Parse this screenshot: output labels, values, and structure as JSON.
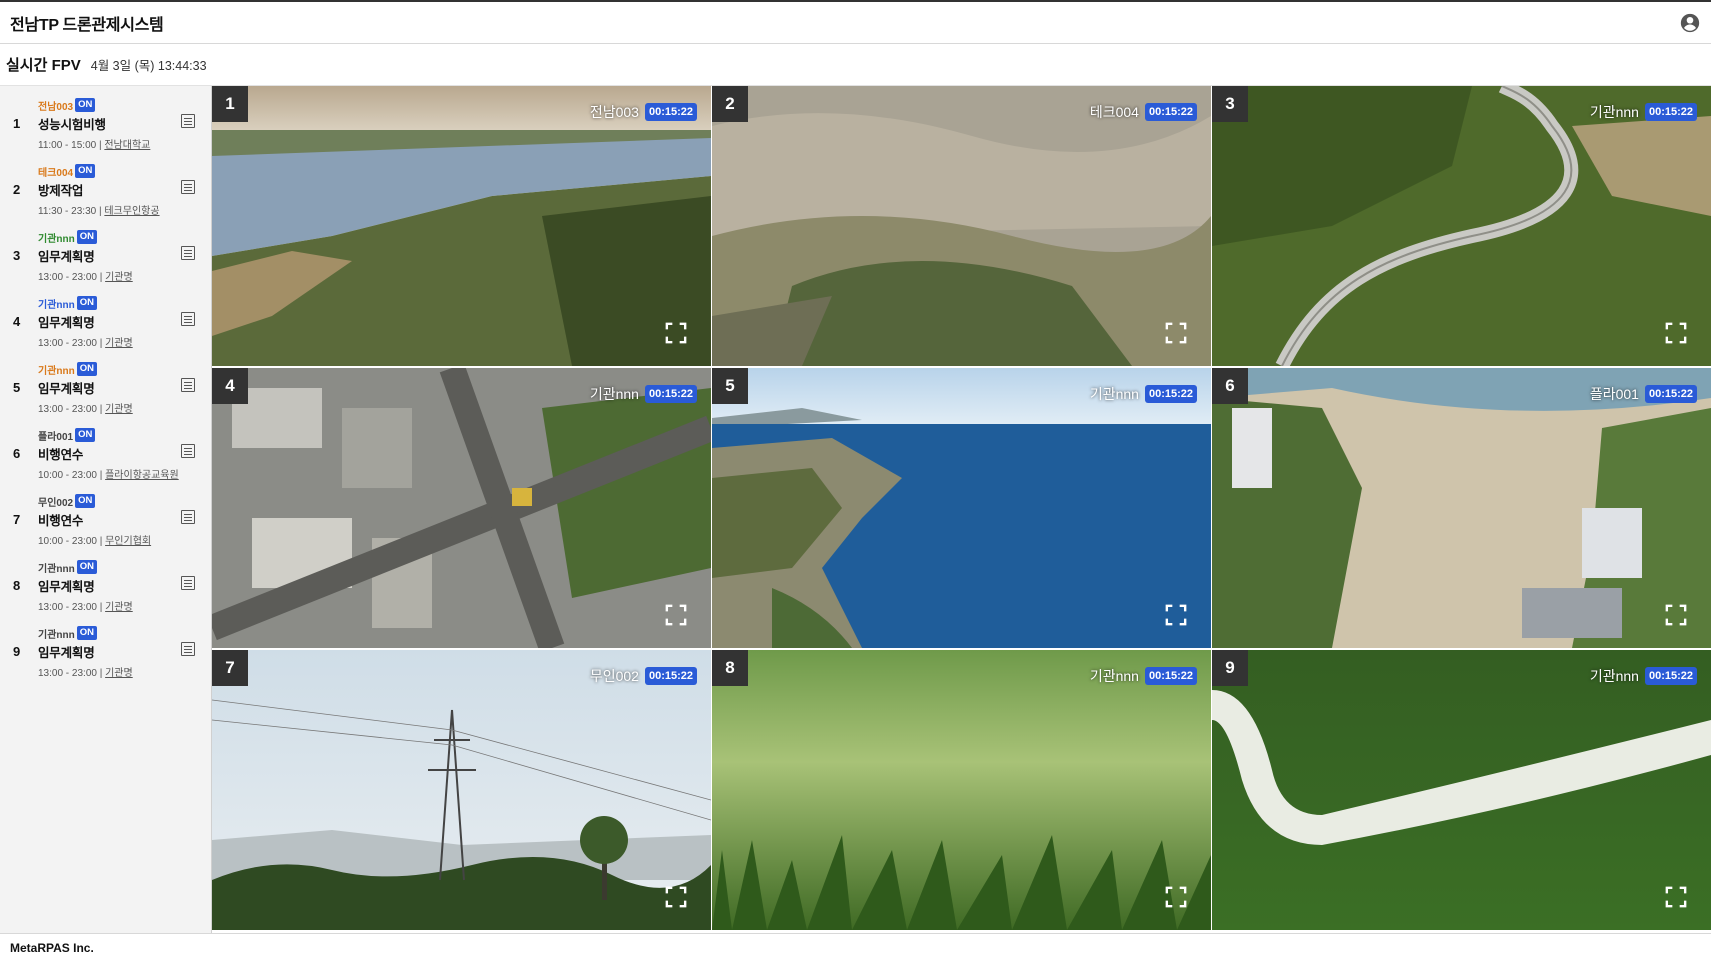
{
  "header": {
    "title": "전남TP 드론관제시스템",
    "account_icon": "account-circle-icon"
  },
  "subheader": {
    "title": "실시간 FPV",
    "datetime": "4월 3일 (목) 13:44:33"
  },
  "colors": {
    "accent": "#2a5bd7",
    "drone_orange": "#d9791a",
    "drone_green": "#2f8a2f",
    "drone_gray": "#444444"
  },
  "flights": [
    {
      "no": "1",
      "drone": "전남003",
      "status": "ON",
      "mission": "성능시험비행",
      "time": "11:00 - 15:00 |",
      "org": "전남대학교",
      "color": "#d9791a"
    },
    {
      "no": "2",
      "drone": "테크004",
      "status": "ON",
      "mission": "방제작업",
      "time": "11:30 - 23:30 |",
      "org": "테크무인항공",
      "color": "#d9791a"
    },
    {
      "no": "3",
      "drone": "기관nnn",
      "status": "ON",
      "mission": "임무계획명",
      "time": "13:00 - 23:00 |",
      "org": "기관명",
      "color": "#2f8a2f"
    },
    {
      "no": "4",
      "drone": "기관nnn",
      "status": "ON",
      "mission": "임무계획명",
      "time": "13:00 - 23:00 |",
      "org": "기관명",
      "color": "#2a5bd7"
    },
    {
      "no": "5",
      "drone": "기관nnn",
      "status": "ON",
      "mission": "임무계획명",
      "time": "13:00 - 23:00 |",
      "org": "기관명",
      "color": "#d9791a"
    },
    {
      "no": "6",
      "drone": "플라001",
      "status": "ON",
      "mission": "비행연수",
      "time": "10:00 - 23:00 |",
      "org": "플라이항공교육원",
      "color": "#444444"
    },
    {
      "no": "7",
      "drone": "무인002",
      "status": "ON",
      "mission": "비행연수",
      "time": "10:00 - 23:00 |",
      "org": "무인기협회",
      "color": "#444444"
    },
    {
      "no": "8",
      "drone": "기관nnn",
      "status": "ON",
      "mission": "임무계획명",
      "time": "13:00 - 23:00 |",
      "org": "기관명",
      "color": "#444444"
    },
    {
      "no": "9",
      "drone": "기관nnn",
      "status": "ON",
      "mission": "임무계획명",
      "time": "13:00 - 23:00 |",
      "org": "기관명",
      "color": "#444444"
    }
  ],
  "tiles": [
    {
      "no": "1",
      "drone": "전남003",
      "elapsed": "00:15:22"
    },
    {
      "no": "2",
      "drone": "테크004",
      "elapsed": "00:15:22"
    },
    {
      "no": "3",
      "drone": "기관nnn",
      "elapsed": "00:15:22"
    },
    {
      "no": "4",
      "drone": "기관nnn",
      "elapsed": "00:15:22"
    },
    {
      "no": "5",
      "drone": "기관nnn",
      "elapsed": "00:15:22"
    },
    {
      "no": "6",
      "drone": "플라001",
      "elapsed": "00:15:22"
    },
    {
      "no": "7",
      "drone": "무인002",
      "elapsed": "00:15:22"
    },
    {
      "no": "8",
      "drone": "기관nnn",
      "elapsed": "00:15:22"
    },
    {
      "no": "9",
      "drone": "기관nnn",
      "elapsed": "00:15:22"
    }
  ],
  "footer": {
    "company": "MetaRPAS Inc."
  }
}
